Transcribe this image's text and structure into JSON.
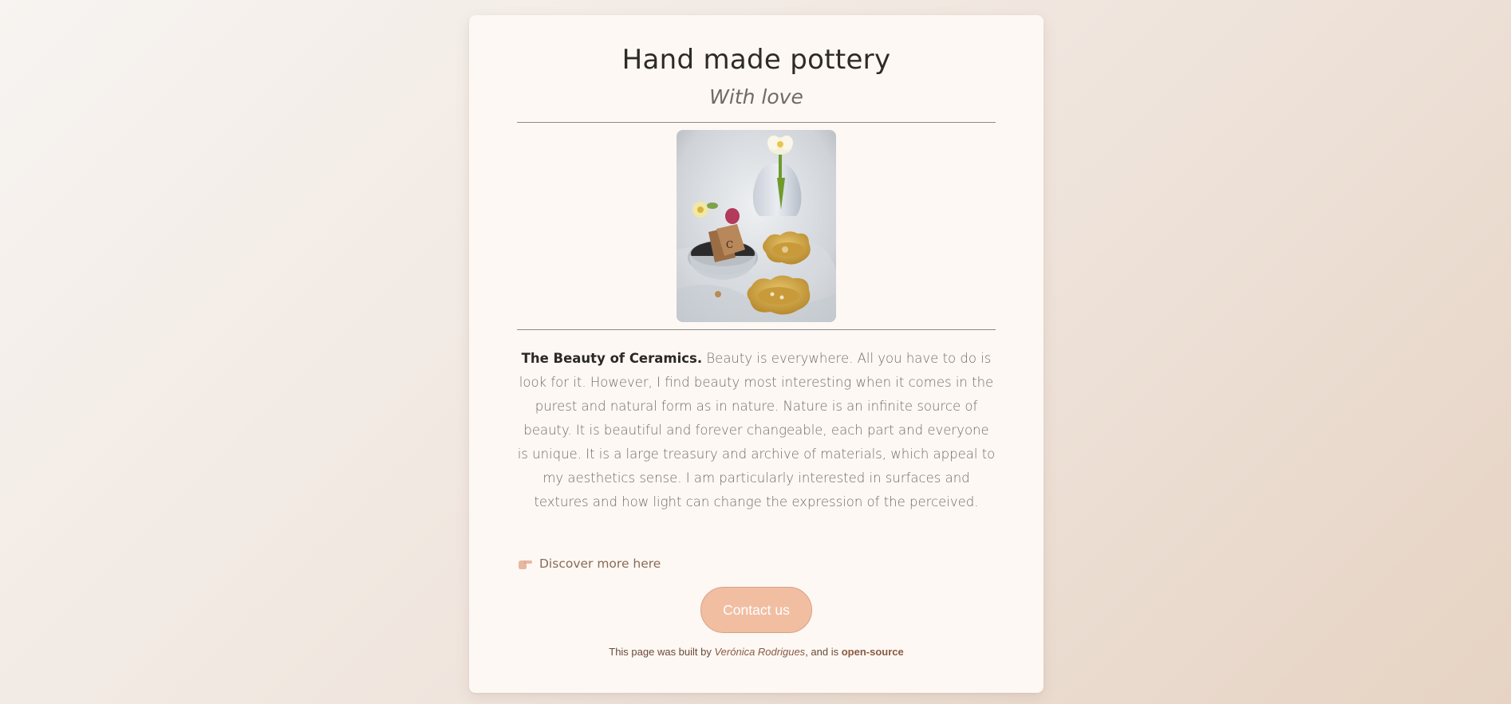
{
  "header": {
    "title": "Hand made pottery",
    "subtitle": "With love"
  },
  "hero_image": {
    "description": "Ceramic vase with a tulip, small ceramic dishes and gift tags on white linen"
  },
  "article": {
    "lead": "The Beauty of Ceramics.",
    "body": " Beauty is everywhere. All you have to do is look for it. However, I find beauty most interesting when it comes in the purest and natural form as in nature. Nature is an infinite source of beauty. It is beautiful and forever changeable, each part and everyone is unique. It is a large treasury and archive of materials, which appeal to my aesthetics sense. I am particularly interested in surfaces and textures and how light can change the expression of the perceived."
  },
  "discover_link": {
    "icon": "pointing-hand-icon",
    "label": "Discover more here"
  },
  "contact_button": {
    "label": "Contact us"
  },
  "footer": {
    "prefix": "This page was built by ",
    "author": "Verónica Rodrigues",
    "middle": ", and is ",
    "license": "open-source"
  },
  "colors": {
    "accent_button": "#f1bea2",
    "link_text": "#8a6a58",
    "card_background": "#fdf8f3"
  }
}
